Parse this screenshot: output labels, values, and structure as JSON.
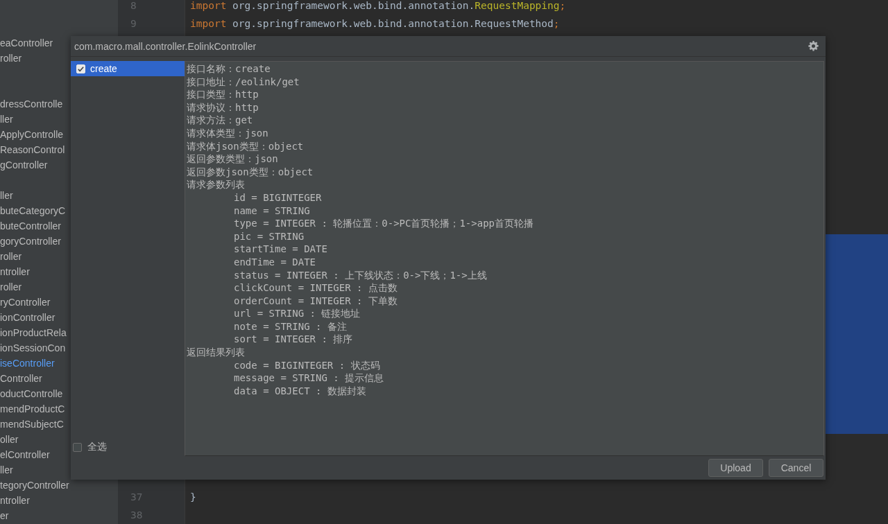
{
  "project_tree": {
    "groups": [
      {
        "items": [
          {
            "label": "eaController",
            "selected": false
          },
          {
            "label": "roller",
            "selected": false
          }
        ]
      },
      {
        "items": [
          {
            "label": "dressControlle",
            "selected": false
          },
          {
            "label": "ller",
            "selected": false
          },
          {
            "label": "ApplyControlle",
            "selected": false
          },
          {
            "label": "ReasonControl",
            "selected": false
          },
          {
            "label": "gController",
            "selected": false
          }
        ]
      },
      {
        "items": [
          {
            "label": "ller",
            "selected": false
          },
          {
            "label": "buteCategoryC",
            "selected": false
          },
          {
            "label": "buteController",
            "selected": false
          },
          {
            "label": "goryController",
            "selected": false
          },
          {
            "label": "roller",
            "selected": false
          },
          {
            "label": "ntroller",
            "selected": false
          },
          {
            "label": "roller",
            "selected": false
          },
          {
            "label": "ryController",
            "selected": false
          },
          {
            "label": "ionController",
            "selected": false
          },
          {
            "label": "ionProductRela",
            "selected": false
          },
          {
            "label": "ionSessionCon",
            "selected": false
          },
          {
            "label": "iseController",
            "selected": true
          },
          {
            "label": "Controller",
            "selected": false
          },
          {
            "label": "oductControlle",
            "selected": false
          },
          {
            "label": "mendProductC",
            "selected": false
          },
          {
            "label": "mendSubjectC",
            "selected": false
          },
          {
            "label": "oller",
            "selected": false
          },
          {
            "label": "elController",
            "selected": false
          },
          {
            "label": "ller",
            "selected": false
          },
          {
            "label": "tegoryController",
            "selected": false
          },
          {
            "label": "ntroller",
            "selected": false
          },
          {
            "label": "er",
            "selected": false
          }
        ]
      }
    ]
  },
  "editor": {
    "top_lines": [
      {
        "number": "8",
        "tokens": [
          {
            "kind": "keyword",
            "text": "import"
          },
          {
            "kind": "plain",
            "text": " org.springframework.web.bind.annotation."
          },
          {
            "kind": "unused",
            "text": "RequestMapping"
          },
          {
            "kind": "punct",
            "text": ";"
          }
        ]
      },
      {
        "number": "9",
        "tokens": [
          {
            "kind": "keyword",
            "text": "import"
          },
          {
            "kind": "plain",
            "text": " org.springframework.web.bind.annotation.RequestMethod"
          },
          {
            "kind": "punct",
            "text": ";"
          }
        ]
      }
    ],
    "bottom_lines": [
      {
        "number": "37",
        "tokens": [
          {
            "kind": "plain",
            "text": "}"
          }
        ]
      },
      {
        "number": "38"
      }
    ]
  },
  "dialog": {
    "title": "com.macro.mall.controller.EolinkController",
    "methods": [
      {
        "label": "create",
        "checked": true,
        "selected": true
      }
    ],
    "select_all": {
      "label": "全选",
      "checked": false
    },
    "details": [
      {
        "text": "接口名称：create"
      },
      {
        "text": "接口地址：/eolink/get"
      },
      {
        "text": "接口类型：http"
      },
      {
        "text": "请求协议：http"
      },
      {
        "text": "请求方法：get"
      },
      {
        "text": "请求体类型：json"
      },
      {
        "text": "请求体json类型：object"
      },
      {
        "text": "返回参数类型：json"
      },
      {
        "text": "返回参数json类型：object"
      },
      {
        "text": "请求参数列表",
        "children": [
          {
            "text": "id = BIGINTEGER"
          },
          {
            "text": "name = STRING"
          },
          {
            "text": "type = INTEGER : 轮播位置：0->PC首页轮播；1->app首页轮播"
          },
          {
            "text": "pic = STRING"
          },
          {
            "text": "startTime = DATE"
          },
          {
            "text": "endTime = DATE"
          },
          {
            "text": "status = INTEGER : 上下线状态：0->下线；1->上线"
          },
          {
            "text": "clickCount = INTEGER : 点击数"
          },
          {
            "text": "orderCount = INTEGER : 下单数"
          },
          {
            "text": "url = STRING : 链接地址"
          },
          {
            "text": "note = STRING : 备注"
          },
          {
            "text": "sort = INTEGER : 排序"
          }
        ]
      },
      {
        "text": "返回结果列表",
        "children": [
          {
            "text": "code = BIGINTEGER : 状态码"
          },
          {
            "text": "message = STRING : 提示信息"
          },
          {
            "text": "data = OBJECT : 数据封装"
          }
        ]
      }
    ],
    "buttons": [
      {
        "label": "Upload"
      },
      {
        "label": "Cancel"
      }
    ]
  }
}
